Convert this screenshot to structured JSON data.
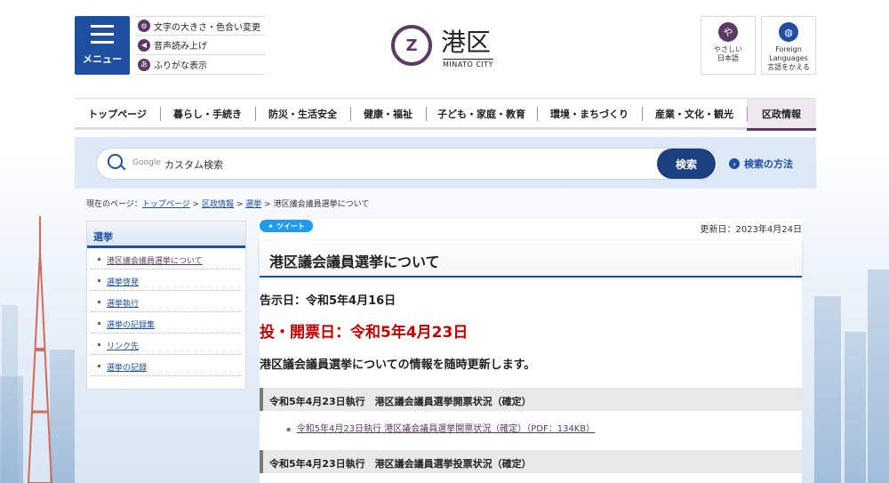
{
  "header": {
    "menu_label": "メニュー",
    "assist": [
      {
        "icon": "text-size-color-icon",
        "label": "文字の大きさ・色合い変更"
      },
      {
        "icon": "speaker-icon",
        "label": "音声読み上げ"
      },
      {
        "icon": "furigana-icon",
        "label": "ふりがな表示"
      }
    ],
    "logo_jp": "港区",
    "logo_en": "MINATO CITY",
    "easy_japanese_label_1": "やさしい",
    "easy_japanese_label_2": "日本語",
    "easy_japanese_glyph": "や",
    "foreign_label_1": "Foreign",
    "foreign_label_2": "Languages",
    "foreign_label_3": "言語をかえる"
  },
  "nav": {
    "items": [
      "トップページ",
      "暮らし・手続き",
      "防災・生活安全",
      "健康・福祉",
      "子ども・家庭・教育",
      "環境・まちづくり",
      "産業・文化・観光",
      "区政情報"
    ]
  },
  "search": {
    "google_label": "Google",
    "placeholder": "カスタム検索",
    "button": "検索",
    "howto": "検索の方法"
  },
  "breadcrumb": {
    "prefix": "現在のページ：",
    "items": [
      "トップページ",
      "区政情報",
      "選挙"
    ],
    "separator": ">",
    "current": "港区議会議員選挙について"
  },
  "sidebar": {
    "title": "選挙",
    "items": [
      "港区議会議員選挙について",
      "選挙啓発",
      "選挙執行",
      "選挙の記録集",
      "リンク先",
      "選挙の記録"
    ]
  },
  "main": {
    "tweet": "ツイート",
    "updated": "更新日：2023年4月24日",
    "title": "港区議会議員選挙について",
    "notice": "告示日：令和5年4月16日",
    "voting": "投・開票日：令和5年4月23日",
    "desc": "港区議会議員選挙についての情報を随時更新します。",
    "section1": "令和5年4月23日執行　港区議会議員選挙開票状況（確定）",
    "section1_link": "令和5年4月23日執行 港区議会議員選挙開票状況（確定）（PDF：134KB）",
    "section2": "令和5年4月23日執行　港区議会議員選挙投票状況（確定）"
  },
  "colors": {
    "brand_purple": "#5b3a63",
    "brand_blue": "#1f4fa0",
    "alert_red": "#c40000"
  }
}
